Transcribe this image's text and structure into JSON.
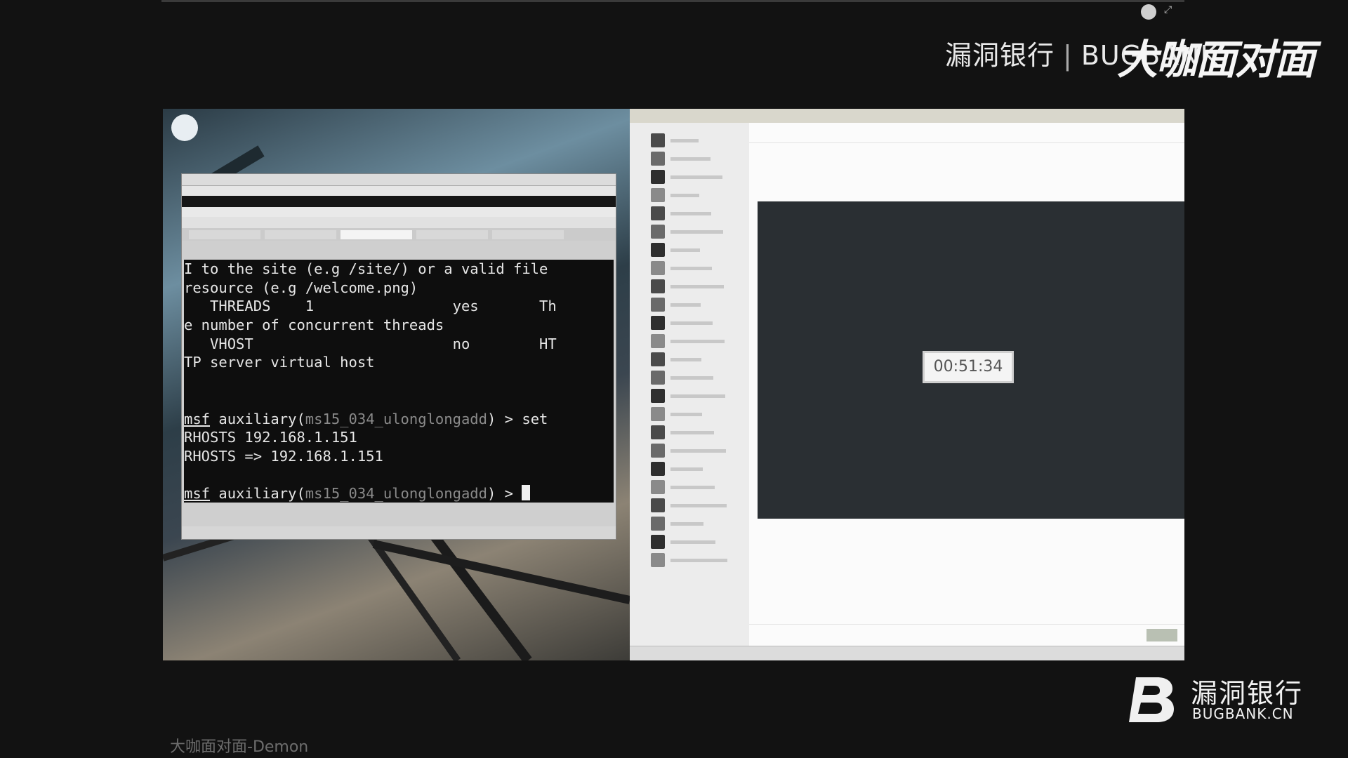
{
  "brand_top": {
    "cn": "漏洞银行",
    "sep": "|",
    "en": "BUGBANK",
    "script": "大咖面对面"
  },
  "terminal": {
    "lines": [
      {
        "pre": "I to the site (e.g /site/) or a valid file",
        "u": "",
        "dim": "",
        "post": ""
      },
      {
        "pre": "resource (e.g /welcome.png)",
        "u": "",
        "dim": "",
        "post": ""
      },
      {
        "pre": "   THREADS    1                yes       Th",
        "u": "",
        "dim": "",
        "post": ""
      },
      {
        "pre": "e number of concurrent threads",
        "u": "",
        "dim": "",
        "post": ""
      },
      {
        "pre": "   VHOST                       no        HT",
        "u": "",
        "dim": "",
        "post": ""
      },
      {
        "pre": "TP server virtual host",
        "u": "",
        "dim": "",
        "post": ""
      },
      {
        "pre": "",
        "u": "",
        "dim": "",
        "post": ""
      },
      {
        "pre": "",
        "u": "",
        "dim": "",
        "post": ""
      },
      {
        "pre": "",
        "u": "msf",
        "dim": "ms15_034_ulonglongadd",
        "post": " > set"
      },
      {
        "pre": "RHOSTS 192.168.1.151",
        "u": "",
        "dim": "",
        "post": ""
      },
      {
        "pre": "RHOSTS => 192.168.1.151",
        "u": "",
        "dim": "",
        "post": ""
      },
      {
        "pre": "",
        "u": "",
        "dim": "",
        "post": ""
      },
      {
        "pre": "",
        "u": "msf",
        "dim": "ms15_034_ulonglongadd",
        "post": " > "
      }
    ],
    "prompt_word": " auxiliary(",
    "prompt_close": ")"
  },
  "stream": {
    "timer": "00:51:34"
  },
  "brand_bottom": {
    "cn": "漏洞银行",
    "en": "BUGBANK.CN"
  },
  "watermark": "大咖面对面-Demon"
}
